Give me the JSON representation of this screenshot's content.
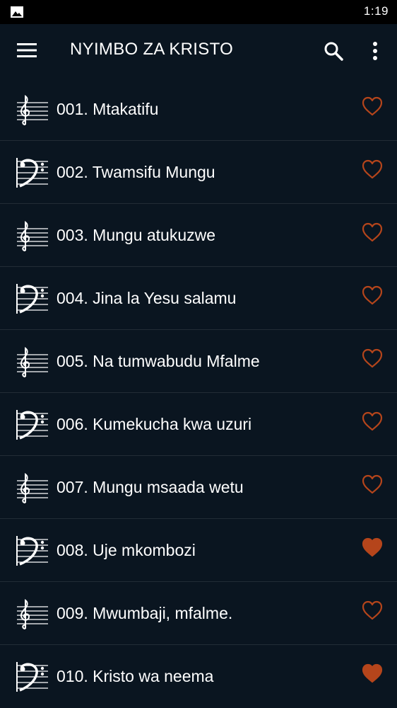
{
  "status_bar": {
    "time": "1:19",
    "icon": "image-icon"
  },
  "app_bar": {
    "title": "NYIMBO ZA KRISTO",
    "menu_icon": "hamburger-menu-icon",
    "search_icon": "search-icon",
    "more_icon": "more-vertical-icon"
  },
  "colors": {
    "background": "#0a1520",
    "status_bar": "#000000",
    "heart": "#b5451b",
    "text": "#ffffff"
  },
  "songs": [
    {
      "title": "001. Mtakatifu",
      "clef": "treble-clef-icon",
      "favorite": false
    },
    {
      "title": "002. Twamsifu Mungu",
      "clef": "bass-clef-icon",
      "favorite": false
    },
    {
      "title": "003. Mungu atukuzwe",
      "clef": "treble-clef-icon",
      "favorite": false
    },
    {
      "title": "004. Jina la Yesu salamu",
      "clef": "bass-clef-icon",
      "favorite": false
    },
    {
      "title": "005. Na tumwabudu Mfalme",
      "clef": "treble-clef-icon",
      "favorite": false
    },
    {
      "title": "006. Kumekucha kwa uzuri",
      "clef": "bass-clef-icon",
      "favorite": false
    },
    {
      "title": "007. Mungu msaada wetu",
      "clef": "treble-clef-icon",
      "favorite": false
    },
    {
      "title": "008. Uje mkombozi",
      "clef": "bass-clef-icon",
      "favorite": true
    },
    {
      "title": "009. Mwumbaji, mfalme.",
      "clef": "treble-clef-icon",
      "favorite": false
    },
    {
      "title": "010. Kristo wa neema",
      "clef": "bass-clef-icon",
      "favorite": true
    }
  ]
}
